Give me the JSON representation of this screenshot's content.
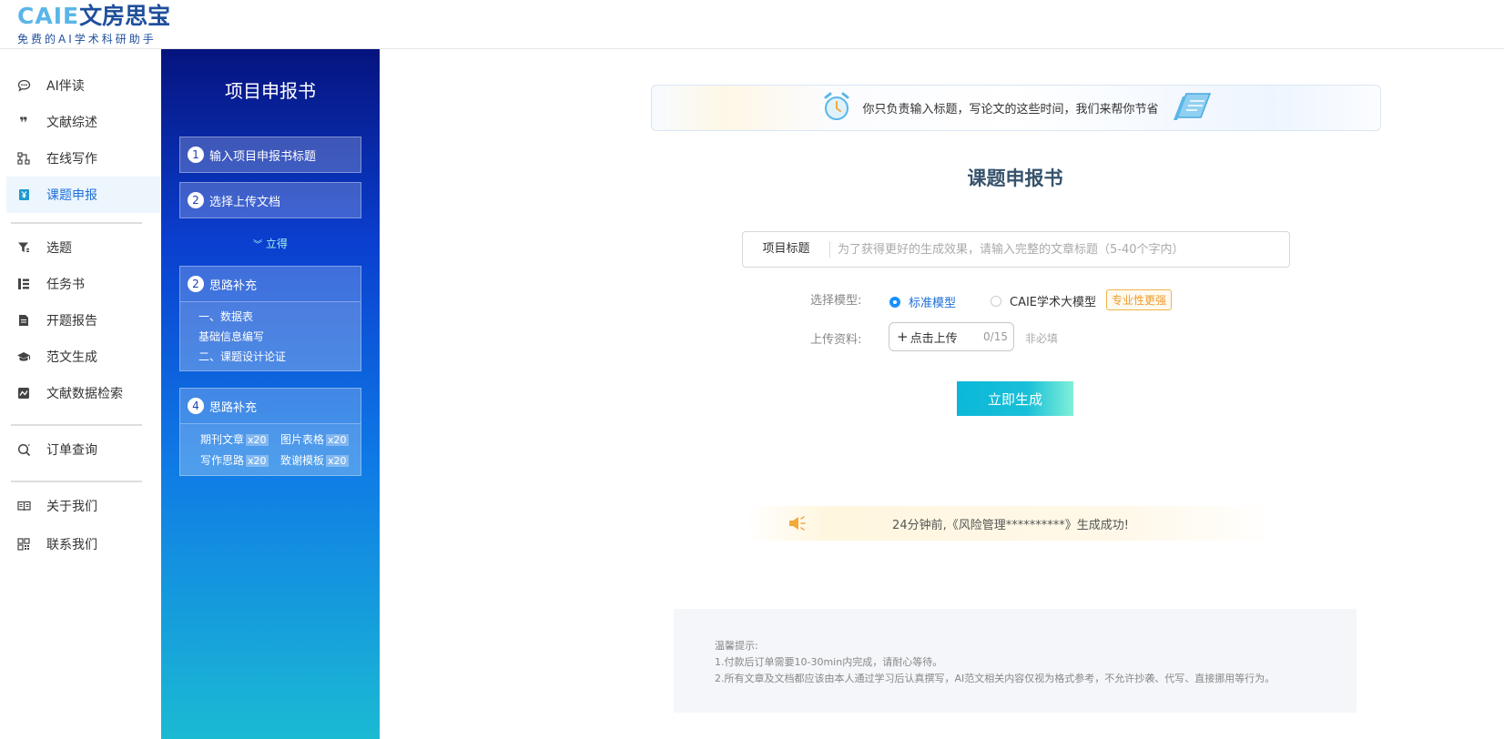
{
  "logo": {
    "brand": "CAIE",
    "name": "文房思宝",
    "slogan": "免费的AI学术科研助手"
  },
  "nav": {
    "items": [
      {
        "label": "AI伴读",
        "icon": "chat-bubble-icon"
      },
      {
        "label": "文献综述",
        "icon": "quote-icon"
      },
      {
        "label": "在线写作",
        "icon": "flow-icon"
      },
      {
        "label": "课题申报",
        "icon": "yen-document-icon",
        "active": true
      },
      {
        "label": "选题",
        "icon": "filter-icon"
      },
      {
        "label": "任务书",
        "icon": "list-icon"
      },
      {
        "label": "开题报告",
        "icon": "file-icon"
      },
      {
        "label": "范文生成",
        "icon": "graduation-cap-icon"
      },
      {
        "label": "文献数据检索",
        "icon": "chart-icon"
      },
      {
        "label": "订单查询",
        "icon": "search-order-icon"
      },
      {
        "label": "关于我们",
        "icon": "book-icon"
      },
      {
        "label": "联系我们",
        "icon": "qrcode-icon"
      }
    ]
  },
  "steps": {
    "title": "项目申报书",
    "step1": {
      "num": "1",
      "label": "输入项目申报书标题"
    },
    "step2": {
      "num": "2",
      "label": "选择上传文档"
    },
    "immediate": "立得",
    "step3": {
      "num": "2",
      "label": "思路补充",
      "lines": [
        "一、数据表",
        "基础信息编写",
        "二、课题设计论证"
      ]
    },
    "step4": {
      "num": "4",
      "label": "思路补充",
      "items": [
        {
          "label": "期刊文章",
          "badge": "x20"
        },
        {
          "label": "图片表格",
          "badge": "x20"
        },
        {
          "label": "写作思路",
          "badge": "x20"
        },
        {
          "label": "致谢模板",
          "badge": "x20"
        }
      ]
    }
  },
  "banner": {
    "text": "你只负责输入标题，写论文的这些时间，我们来帮你节省"
  },
  "form": {
    "title": "课题申报书",
    "project_label": "项目标题",
    "project_placeholder": "为了获得更好的生成效果，请输入完整的文章标题（5-40个字内）",
    "model_label": "选择模型:",
    "model_standard": "标准模型",
    "model_caie": "CAIE学术大模型",
    "model_tag": "专业性更强",
    "upload_label": "上传资料:",
    "upload_button": "点击上传",
    "upload_count": "0/15",
    "upload_optional": "非必填",
    "generate": "立即生成"
  },
  "notice": {
    "text": "24分钟前,《风险管理**********》生成成功!"
  },
  "tips": {
    "title": "温馨提示:",
    "line1": "1.付款后订单需要10-30min内完成，请耐心等待。",
    "line2": "2.所有文章及文档都应该由本人通过学习后认真撰写，AI范文相关内容仅视为格式参考，不允许抄袭、代写、直接挪用等行为。"
  },
  "colors": {
    "accent": "#1e6fd9",
    "panel_top": "#06137e",
    "panel_bottom": "#1bbad3",
    "button": "#0bb8d8",
    "tag": "#f09a2a"
  }
}
